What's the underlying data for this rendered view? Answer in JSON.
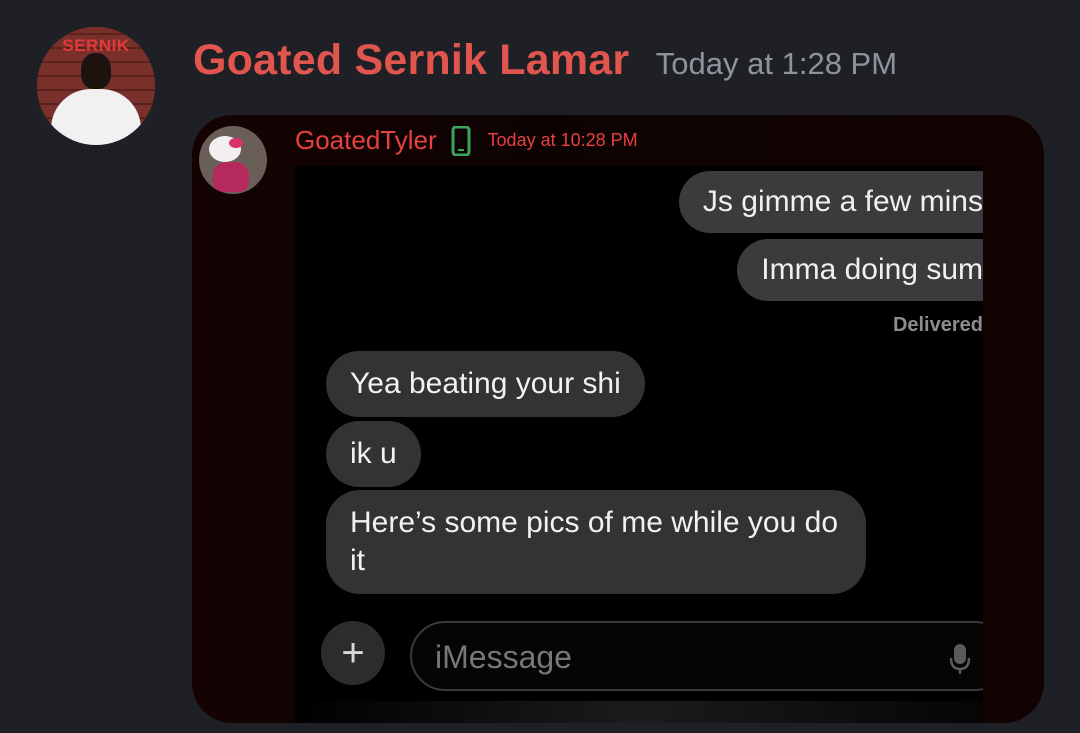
{
  "message": {
    "avatar_text": "SERNIK",
    "username": "Goated Sernik Lamar",
    "timestamp": "Today at 1:28 PM"
  },
  "embed": {
    "username": "GoatedTyler",
    "timestamp": "Today at 10:28 PM",
    "device_icon": "mobile-phone-icon",
    "imessage": {
      "sent": [
        "Js gimme a few mins",
        "Imma doing sum"
      ],
      "delivered": "Delivered",
      "received": [
        "Yea beating your shi",
        "ik u",
        "Here’s some pics of me while you do it"
      ],
      "input_placeholder": "iMessage",
      "plus_label": "+"
    }
  },
  "colors": {
    "background": "#1f2025",
    "username_red": "#e0554e",
    "inner_red": "#e4413f",
    "online_green": "#3ba55c",
    "bubble_gray": "#333335"
  }
}
